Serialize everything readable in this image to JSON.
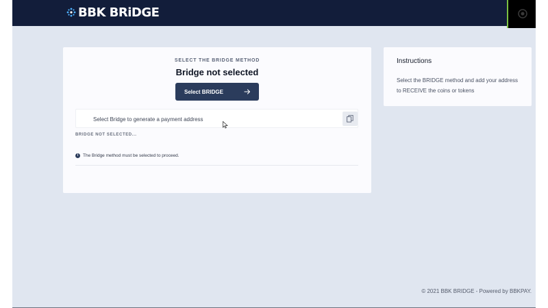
{
  "header": {
    "logo_text": "BBK BRiDGE",
    "logo_icon": "bbk-dots-logo-icon",
    "corner_icon": "coin-settings-icon",
    "colors": {
      "bar": "#121d3a",
      "accent": "#7bc242",
      "logo_mark": "#4fb3ff"
    }
  },
  "main": {
    "eyebrow": "SELECT THE BRIDGE METHOD",
    "title": "Bridge not selected",
    "select_button": {
      "label": "Select BRIDGE",
      "icon": "arrow-right-icon"
    },
    "address": {
      "text": "Select Bridge to generate a payment address",
      "copy_icon": "copy-icon"
    },
    "status_label": "BRIDGE NOT SELECTED...",
    "notice": {
      "icon": "info-icon",
      "text": "The Bridge method must be selected to proceed."
    }
  },
  "instructions": {
    "title": "Instructions",
    "text": "Select the BRIDGE method and add your address to RECEIVE the coins or tokens"
  },
  "footer": {
    "text": "© 2021 BBK BRIDGE - Powered by BBKPAY."
  }
}
